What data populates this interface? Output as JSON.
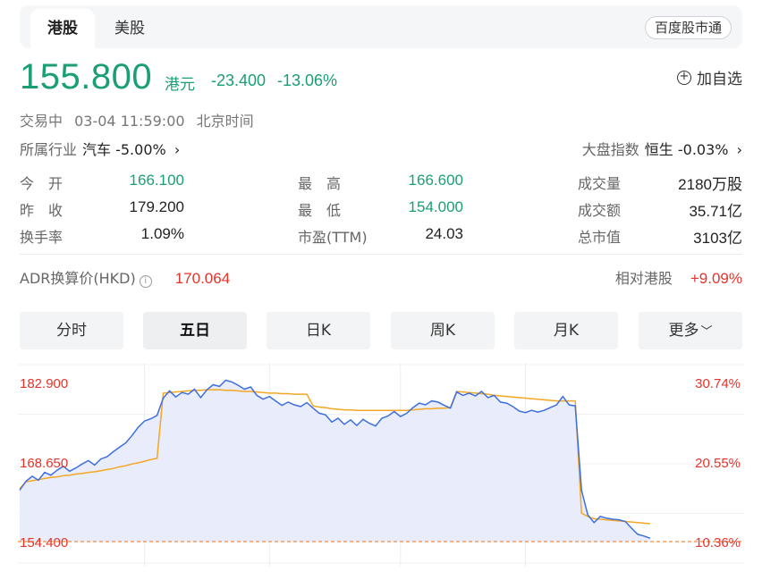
{
  "tabs": {
    "hk": "港股",
    "us": "美股",
    "connect": "百度股市通"
  },
  "quote": {
    "price": "155.800",
    "currency": "港元",
    "change": "-23.400",
    "change_pct": "-13.06%",
    "add_watch": "加自选"
  },
  "status": {
    "state": "交易中",
    "datetime": "03-04 11:59:00",
    "tz": "北京时间"
  },
  "industry": {
    "label": "所属行业",
    "value": "汽车 -5.00%",
    "arrow": "›"
  },
  "index": {
    "label": "大盘指数",
    "value": "恒生 -0.03%",
    "arrow": "›"
  },
  "stats": {
    "open": {
      "label": "今　开",
      "value": "166.100"
    },
    "prev_close": {
      "label": "昨　收",
      "value": "179.200"
    },
    "turnover_rate": {
      "label": "换手率",
      "value": "1.09%"
    },
    "high": {
      "label": "最　高",
      "value": "166.600"
    },
    "low": {
      "label": "最　低",
      "value": "154.000"
    },
    "pe": {
      "label": "市盈(TTM)",
      "value": "24.03"
    },
    "volume": {
      "label": "成交量",
      "value": "2180万股"
    },
    "amount": {
      "label": "成交额",
      "value": "35.71亿"
    },
    "mktcap": {
      "label": "总市值",
      "value": "3103亿"
    }
  },
  "adr": {
    "label": "ADR换算价(HKD)",
    "info_icon": "i",
    "value": "170.064",
    "rel_label": "相对港股",
    "rel_value": "+9.09%"
  },
  "periods": [
    "分时",
    "五日",
    "日K",
    "周K",
    "月K",
    "更多"
  ],
  "active_period": "五日",
  "colors": {
    "up": "#e5332a",
    "down": "#1a9e75",
    "line": "#3d6fe0",
    "avg": "#f5a623",
    "fill": "#e8ecfb"
  },
  "chart_data": {
    "type": "line",
    "y_labels_left": [
      "182.900",
      "168.650",
      "154.400"
    ],
    "y_labels_right": [
      "30.74%",
      "20.55%",
      "10.36%"
    ],
    "ylim": [
      154.4,
      182.9
    ],
    "days": 5,
    "price_line": [
      163.6,
      165.2,
      166.1,
      165.4,
      166.8,
      166.3,
      167.2,
      167.9,
      167.0,
      167.6,
      168.3,
      168.9,
      168.1,
      169.2,
      169.6,
      170.5,
      171.3,
      172.1,
      173.4,
      174.9,
      176.0,
      176.4,
      177.0,
      180.1,
      181.4,
      180.3,
      181.1,
      180.8,
      181.7,
      180.2,
      181.6,
      182.5,
      182.2,
      183.3,
      183.0,
      182.4,
      181.7,
      182.1,
      180.6,
      179.9,
      180.4,
      179.6,
      178.8,
      179.4,
      178.9,
      178.6,
      179.3,
      178.3,
      177.4,
      177.1,
      175.8,
      176.5,
      175.4,
      176.2,
      175.2,
      176.3,
      175.6,
      175.1,
      176.5,
      176.9,
      177.7,
      176.8,
      177.4,
      178.4,
      179.2,
      178.9,
      179.6,
      179.4,
      178.8,
      178.3,
      181.2,
      180.6,
      181.0,
      180.5,
      181.3,
      180.2,
      180.6,
      179.4,
      179.2,
      178.6,
      177.8,
      177.5,
      177.9,
      177.6,
      177.9,
      178.4,
      178.9,
      180.4,
      178.9,
      178.7,
      163.6,
      159.2,
      157.8,
      158.9,
      158.6,
      158.4,
      158.3,
      158.0,
      156.8,
      155.7,
      155.4,
      155.0
    ],
    "avg_line": [
      163.9,
      165.1,
      165.3,
      165.5,
      165.7,
      165.9,
      166.0,
      166.2,
      166.3,
      166.5,
      166.6,
      166.8,
      166.9,
      167.1,
      167.3,
      167.5,
      167.8,
      168.0,
      168.3,
      168.5,
      168.8,
      169.1,
      169.3,
      181.0,
      181.1,
      181.2,
      181.3,
      181.4,
      181.5,
      181.5,
      181.6,
      181.6,
      181.6,
      181.5,
      181.5,
      181.4,
      181.3,
      181.3,
      181.2,
      181.1,
      181.0,
      181.0,
      180.9,
      180.9,
      180.8,
      180.8,
      180.8,
      178.7,
      178.5,
      178.4,
      178.2,
      178.1,
      178.0,
      178.0,
      177.9,
      177.9,
      177.9,
      177.9,
      177.9,
      177.9,
      177.9,
      177.9,
      177.9,
      178.0,
      178.1,
      178.2,
      178.2,
      178.3,
      178.3,
      178.4,
      181.3,
      181.2,
      181.1,
      181.0,
      180.9,
      180.8,
      180.6,
      180.5,
      180.4,
      180.3,
      180.2,
      180.1,
      180.0,
      179.9,
      179.8,
      179.7,
      179.6,
      179.6,
      179.6,
      179.6,
      159.5,
      158.9,
      158.5,
      158.4,
      158.3,
      158.2,
      158.1,
      158.0,
      157.9,
      157.8,
      157.7,
      157.6
    ],
    "prev_close_line": 154.4
  }
}
